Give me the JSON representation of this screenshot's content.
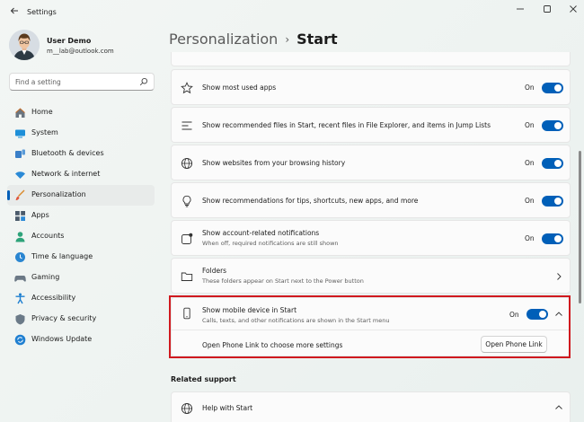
{
  "window": {
    "app_title": "Settings"
  },
  "user": {
    "name": "User Demo",
    "email": "m__lab@outlook.com"
  },
  "search": {
    "placeholder": "Find a setting"
  },
  "sidebar": {
    "items": [
      {
        "label": "Home",
        "icon": "home-icon",
        "active": false
      },
      {
        "label": "System",
        "icon": "system-icon",
        "active": false
      },
      {
        "label": "Bluetooth & devices",
        "icon": "bluetooth-icon",
        "active": false
      },
      {
        "label": "Network & internet",
        "icon": "network-icon",
        "active": false
      },
      {
        "label": "Personalization",
        "icon": "brush-icon",
        "active": true
      },
      {
        "label": "Apps",
        "icon": "apps-icon",
        "active": false
      },
      {
        "label": "Accounts",
        "icon": "accounts-icon",
        "active": false
      },
      {
        "label": "Time & language",
        "icon": "globe-clock-icon",
        "active": false
      },
      {
        "label": "Gaming",
        "icon": "gamepad-icon",
        "active": false
      },
      {
        "label": "Accessibility",
        "icon": "accessibility-icon",
        "active": false
      },
      {
        "label": "Privacy & security",
        "icon": "shield-icon",
        "active": false
      },
      {
        "label": "Windows Update",
        "icon": "update-icon",
        "active": false
      }
    ]
  },
  "header": {
    "parent": "Personalization",
    "separator": "›",
    "current": "Start"
  },
  "settings": {
    "most_used": {
      "title": "Show most used apps",
      "state": "On"
    },
    "recommended_files": {
      "title": "Show recommended files in Start, recent files in File Explorer, and items in Jump Lists",
      "state": "On"
    },
    "websites": {
      "title": "Show websites from your browsing history",
      "state": "On"
    },
    "recommendations": {
      "title": "Show recommendations for tips, shortcuts, new apps, and more",
      "state": "On"
    },
    "account_notifications": {
      "title": "Show account-related notifications",
      "subtitle": "When off, required notifications are still shown",
      "state": "On"
    },
    "folders": {
      "title": "Folders",
      "subtitle": "These folders appear on Start next to the Power button"
    },
    "mobile_device": {
      "title": "Show mobile device in Start",
      "subtitle": "Calls, texts, and other notifications are shown in the Start menu",
      "state": "On"
    },
    "phone_link": {
      "text": "Open Phone Link to choose more settings",
      "button": "Open Phone Link"
    }
  },
  "related_support": {
    "heading": "Related support",
    "help_title": "Help with Start"
  },
  "colors": {
    "accent": "#005fb8",
    "highlight_border": "#d0191f"
  }
}
